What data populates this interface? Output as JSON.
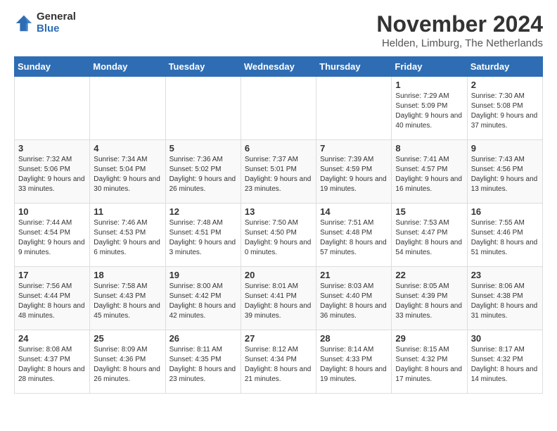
{
  "logo": {
    "general": "General",
    "blue": "Blue"
  },
  "title": "November 2024",
  "location": "Helden, Limburg, The Netherlands",
  "weekdays": [
    "Sunday",
    "Monday",
    "Tuesday",
    "Wednesday",
    "Thursday",
    "Friday",
    "Saturday"
  ],
  "weeks": [
    [
      {
        "day": "",
        "info": ""
      },
      {
        "day": "",
        "info": ""
      },
      {
        "day": "",
        "info": ""
      },
      {
        "day": "",
        "info": ""
      },
      {
        "day": "",
        "info": ""
      },
      {
        "day": "1",
        "info": "Sunrise: 7:29 AM\nSunset: 5:09 PM\nDaylight: 9 hours and 40 minutes."
      },
      {
        "day": "2",
        "info": "Sunrise: 7:30 AM\nSunset: 5:08 PM\nDaylight: 9 hours and 37 minutes."
      }
    ],
    [
      {
        "day": "3",
        "info": "Sunrise: 7:32 AM\nSunset: 5:06 PM\nDaylight: 9 hours and 33 minutes."
      },
      {
        "day": "4",
        "info": "Sunrise: 7:34 AM\nSunset: 5:04 PM\nDaylight: 9 hours and 30 minutes."
      },
      {
        "day": "5",
        "info": "Sunrise: 7:36 AM\nSunset: 5:02 PM\nDaylight: 9 hours and 26 minutes."
      },
      {
        "day": "6",
        "info": "Sunrise: 7:37 AM\nSunset: 5:01 PM\nDaylight: 9 hours and 23 minutes."
      },
      {
        "day": "7",
        "info": "Sunrise: 7:39 AM\nSunset: 4:59 PM\nDaylight: 9 hours and 19 minutes."
      },
      {
        "day": "8",
        "info": "Sunrise: 7:41 AM\nSunset: 4:57 PM\nDaylight: 9 hours and 16 minutes."
      },
      {
        "day": "9",
        "info": "Sunrise: 7:43 AM\nSunset: 4:56 PM\nDaylight: 9 hours and 13 minutes."
      }
    ],
    [
      {
        "day": "10",
        "info": "Sunrise: 7:44 AM\nSunset: 4:54 PM\nDaylight: 9 hours and 9 minutes."
      },
      {
        "day": "11",
        "info": "Sunrise: 7:46 AM\nSunset: 4:53 PM\nDaylight: 9 hours and 6 minutes."
      },
      {
        "day": "12",
        "info": "Sunrise: 7:48 AM\nSunset: 4:51 PM\nDaylight: 9 hours and 3 minutes."
      },
      {
        "day": "13",
        "info": "Sunrise: 7:50 AM\nSunset: 4:50 PM\nDaylight: 9 hours and 0 minutes."
      },
      {
        "day": "14",
        "info": "Sunrise: 7:51 AM\nSunset: 4:48 PM\nDaylight: 8 hours and 57 minutes."
      },
      {
        "day": "15",
        "info": "Sunrise: 7:53 AM\nSunset: 4:47 PM\nDaylight: 8 hours and 54 minutes."
      },
      {
        "day": "16",
        "info": "Sunrise: 7:55 AM\nSunset: 4:46 PM\nDaylight: 8 hours and 51 minutes."
      }
    ],
    [
      {
        "day": "17",
        "info": "Sunrise: 7:56 AM\nSunset: 4:44 PM\nDaylight: 8 hours and 48 minutes."
      },
      {
        "day": "18",
        "info": "Sunrise: 7:58 AM\nSunset: 4:43 PM\nDaylight: 8 hours and 45 minutes."
      },
      {
        "day": "19",
        "info": "Sunrise: 8:00 AM\nSunset: 4:42 PM\nDaylight: 8 hours and 42 minutes."
      },
      {
        "day": "20",
        "info": "Sunrise: 8:01 AM\nSunset: 4:41 PM\nDaylight: 8 hours and 39 minutes."
      },
      {
        "day": "21",
        "info": "Sunrise: 8:03 AM\nSunset: 4:40 PM\nDaylight: 8 hours and 36 minutes."
      },
      {
        "day": "22",
        "info": "Sunrise: 8:05 AM\nSunset: 4:39 PM\nDaylight: 8 hours and 33 minutes."
      },
      {
        "day": "23",
        "info": "Sunrise: 8:06 AM\nSunset: 4:38 PM\nDaylight: 8 hours and 31 minutes."
      }
    ],
    [
      {
        "day": "24",
        "info": "Sunrise: 8:08 AM\nSunset: 4:37 PM\nDaylight: 8 hours and 28 minutes."
      },
      {
        "day": "25",
        "info": "Sunrise: 8:09 AM\nSunset: 4:36 PM\nDaylight: 8 hours and 26 minutes."
      },
      {
        "day": "26",
        "info": "Sunrise: 8:11 AM\nSunset: 4:35 PM\nDaylight: 8 hours and 23 minutes."
      },
      {
        "day": "27",
        "info": "Sunrise: 8:12 AM\nSunset: 4:34 PM\nDaylight: 8 hours and 21 minutes."
      },
      {
        "day": "28",
        "info": "Sunrise: 8:14 AM\nSunset: 4:33 PM\nDaylight: 8 hours and 19 minutes."
      },
      {
        "day": "29",
        "info": "Sunrise: 8:15 AM\nSunset: 4:32 PM\nDaylight: 8 hours and 17 minutes."
      },
      {
        "day": "30",
        "info": "Sunrise: 8:17 AM\nSunset: 4:32 PM\nDaylight: 8 hours and 14 minutes."
      }
    ]
  ]
}
